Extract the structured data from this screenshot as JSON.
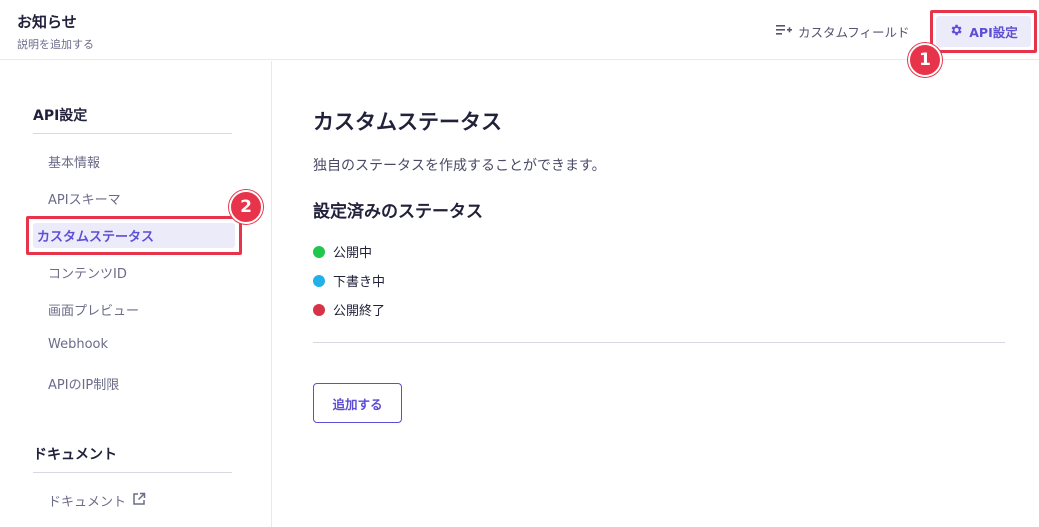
{
  "header": {
    "title": "お知らせ",
    "subtitle": "説明を追加する",
    "custom_field_label": "カスタムフィールド",
    "api_settings_label": "API設定"
  },
  "annotations": {
    "badge_1": "1",
    "badge_2": "2",
    "highlight_color": "#e8344a"
  },
  "sidebar": {
    "sections": [
      {
        "heading": "API設定",
        "items": [
          {
            "label": "基本情報"
          },
          {
            "label": "APIスキーマ"
          },
          {
            "label": "カスタムステータス",
            "active": true
          },
          {
            "label": "コンテンツID"
          },
          {
            "label": "画面プレビュー"
          },
          {
            "label": "Webhook"
          },
          {
            "label": "APIのIP制限"
          }
        ]
      },
      {
        "heading": "ドキュメント",
        "items": [
          {
            "label": "ドキュメント",
            "icon": "external-link-icon"
          }
        ]
      }
    ]
  },
  "main": {
    "title": "カスタムステータス",
    "description": "独自のステータスを作成することができます。",
    "section_title": "設定済みのステータス",
    "statuses": [
      {
        "label": "公開中",
        "color": "#1fc74d"
      },
      {
        "label": "下書き中",
        "color": "#22b0e8"
      },
      {
        "label": "公開終了",
        "color": "#d63348"
      }
    ],
    "add_button": "追加する"
  },
  "colors": {
    "accent": "#5c4fd6",
    "active_bg": "#ecebfa"
  }
}
